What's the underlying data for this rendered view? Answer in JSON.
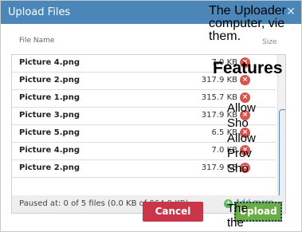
{
  "dialog": {
    "title": "Upload Files",
    "close_glyph": "✕",
    "column_name": "File Name",
    "column_size": "Size",
    "files": [
      {
        "name": "Picture 4.png",
        "size": "7.0 KB"
      },
      {
        "name": "Picture 2.png",
        "size": "317.9 KB"
      },
      {
        "name": "Picture 1.png",
        "size": "315.7 KB"
      },
      {
        "name": "Picture 3.png",
        "size": "317.9 KB"
      },
      {
        "name": "Picture 5.png",
        "size": "6.5 KB"
      },
      {
        "name": "Picture 4.png",
        "size": "7.0 KB"
      },
      {
        "name": "Picture 2.png",
        "size": "317.9 KB"
      }
    ],
    "remove_glyph": "×",
    "status": "Paused at: 0 of 5 files (0.0 KB of 964.9 KB)",
    "add_more": "Add more",
    "add_glyph": "+",
    "cancel": "Cancel",
    "upload": "Upload"
  },
  "background_text": {
    "intro_line1": "The Uploader",
    "intro_line2": "computer, vie",
    "intro_line3": "them.",
    "heading": "Features",
    "items": [
      "Allow",
      "Sho",
      "Allow",
      "Prov",
      "Sho",
      "The",
      "the"
    ]
  },
  "colors": {
    "title_bar": "#4a86b8",
    "cancel": "#c9364a",
    "upload": "#6aad47"
  }
}
